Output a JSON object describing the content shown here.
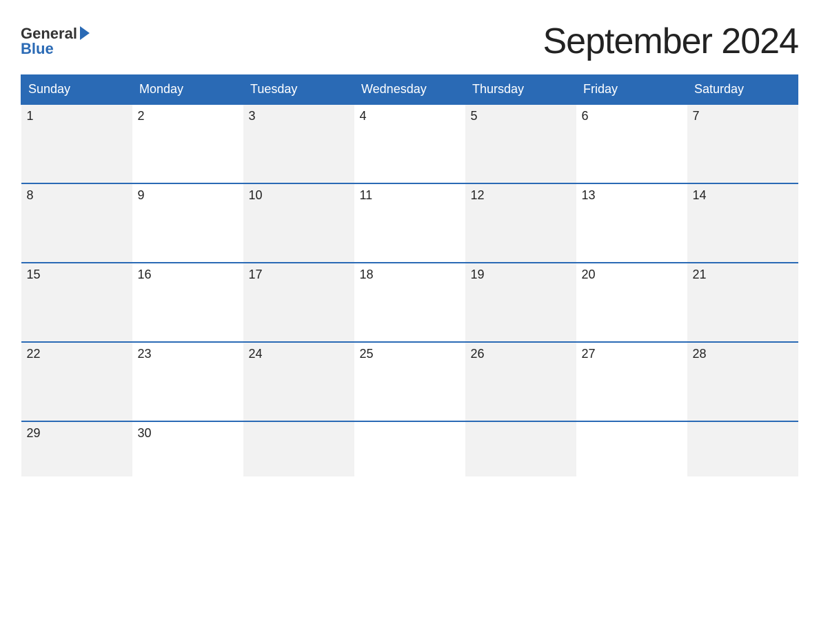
{
  "header": {
    "logo": {
      "general": "General",
      "triangle": "",
      "blue": "Blue"
    },
    "title": "September 2024"
  },
  "calendar": {
    "days_of_week": [
      "Sunday",
      "Monday",
      "Tuesday",
      "Wednesday",
      "Thursday",
      "Friday",
      "Saturday"
    ],
    "weeks": [
      [
        {
          "day": "1",
          "grey": true
        },
        {
          "day": "2",
          "grey": false
        },
        {
          "day": "3",
          "grey": true
        },
        {
          "day": "4",
          "grey": false
        },
        {
          "day": "5",
          "grey": true
        },
        {
          "day": "6",
          "grey": false
        },
        {
          "day": "7",
          "grey": true
        }
      ],
      [
        {
          "day": "8",
          "grey": true
        },
        {
          "day": "9",
          "grey": false
        },
        {
          "day": "10",
          "grey": true
        },
        {
          "day": "11",
          "grey": false
        },
        {
          "day": "12",
          "grey": true
        },
        {
          "day": "13",
          "grey": false
        },
        {
          "day": "14",
          "grey": true
        }
      ],
      [
        {
          "day": "15",
          "grey": true
        },
        {
          "day": "16",
          "grey": false
        },
        {
          "day": "17",
          "grey": true
        },
        {
          "day": "18",
          "grey": false
        },
        {
          "day": "19",
          "grey": true
        },
        {
          "day": "20",
          "grey": false
        },
        {
          "day": "21",
          "grey": true
        }
      ],
      [
        {
          "day": "22",
          "grey": true
        },
        {
          "day": "23",
          "grey": false
        },
        {
          "day": "24",
          "grey": true
        },
        {
          "day": "25",
          "grey": false
        },
        {
          "day": "26",
          "grey": true
        },
        {
          "day": "27",
          "grey": false
        },
        {
          "day": "28",
          "grey": true
        }
      ],
      [
        {
          "day": "29",
          "grey": true
        },
        {
          "day": "30",
          "grey": false
        },
        {
          "day": "",
          "grey": true
        },
        {
          "day": "",
          "grey": false
        },
        {
          "day": "",
          "grey": true
        },
        {
          "day": "",
          "grey": false
        },
        {
          "day": "",
          "grey": true
        }
      ]
    ]
  }
}
